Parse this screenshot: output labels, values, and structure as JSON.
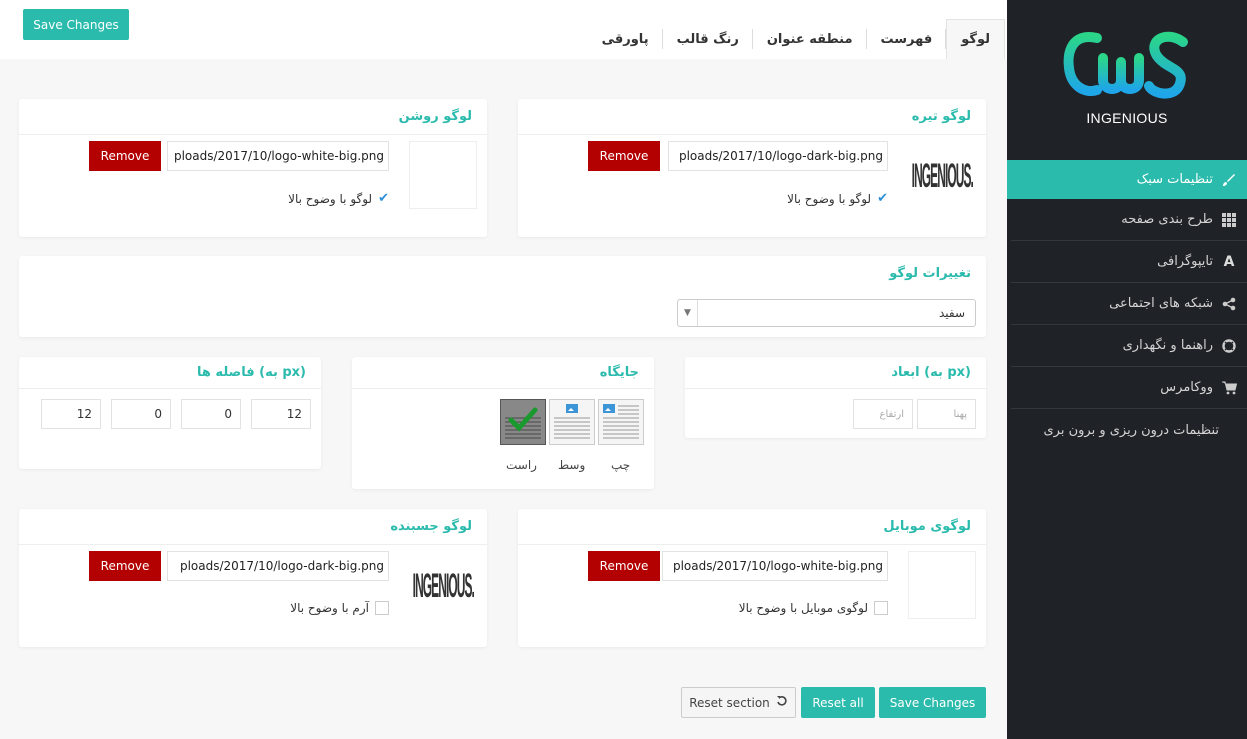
{
  "topbar": {
    "save_label": "Save Changes",
    "tabs": [
      "لوگو",
      "فهرست",
      "منطقه عنوان",
      "رنگ قالب",
      "پاورقی"
    ]
  },
  "sidebar": {
    "logo_text": "INGENIOUS",
    "items": [
      {
        "label": "تنظیمات سبک",
        "icon": "brush-icon"
      },
      {
        "label": "طرح بندی صفحه",
        "icon": "grid-icon"
      },
      {
        "label": "تایپوگرافی",
        "icon": "font-icon"
      },
      {
        "label": "شبکه های اجتماعی",
        "icon": "share-icon"
      },
      {
        "label": "راهنما و نگهداری",
        "icon": "lifebuoy-icon"
      },
      {
        "label": "ووکامرس",
        "icon": "cart-icon"
      },
      {
        "label": "تنظیمات درون ریزی و برون بری",
        "icon": ""
      }
    ]
  },
  "dark_logo": {
    "title": "لوگو تیره",
    "url": "ploads/2017/10/logo-dark-big.png",
    "remove": "Remove",
    "retina_label": "لوگو با وضوح بالا",
    "preview_text": "INGENIOUS."
  },
  "light_logo": {
    "title": "لوگو روشن",
    "url": "ploads/2017/10/logo-white-big.png",
    "remove": "Remove",
    "retina_label": "لوگو با وضوح بالا"
  },
  "logo_variations": {
    "title": "تغییرات لوگو",
    "selected": "سفید"
  },
  "dimensions": {
    "title": "ابعاد (به px)",
    "width_placeholder": "پهنا",
    "height_placeholder": "ارتفاع"
  },
  "position": {
    "title": "جایگاه",
    "options": [
      "چپ",
      "وسط",
      "راست"
    ],
    "selected": "راست"
  },
  "spacing": {
    "title": "فاصله ها (به px)",
    "values": [
      "12",
      "0",
      "0",
      "12"
    ]
  },
  "mobile_logo": {
    "title": "لوگوی موبایل",
    "url": "ploads/2017/10/logo-white-big.png",
    "remove": "Remove",
    "retina_label": "لوگوی موبایل با وضوح بالا"
  },
  "sticky_logo": {
    "title": "لوگو جسبنده",
    "url": "ploads/2017/10/logo-dark-big.png",
    "remove": "Remove",
    "retina_label": "آرم با وضوح بالا",
    "preview_text": "INGENIOUS."
  },
  "footer_buttons": {
    "reset_section": "Reset section",
    "reset_all": "Reset all",
    "save": "Save Changes"
  },
  "colors": {
    "accent": "#2bbbad",
    "sidebar_bg": "#1f2227",
    "remove_red": "#b30000"
  }
}
